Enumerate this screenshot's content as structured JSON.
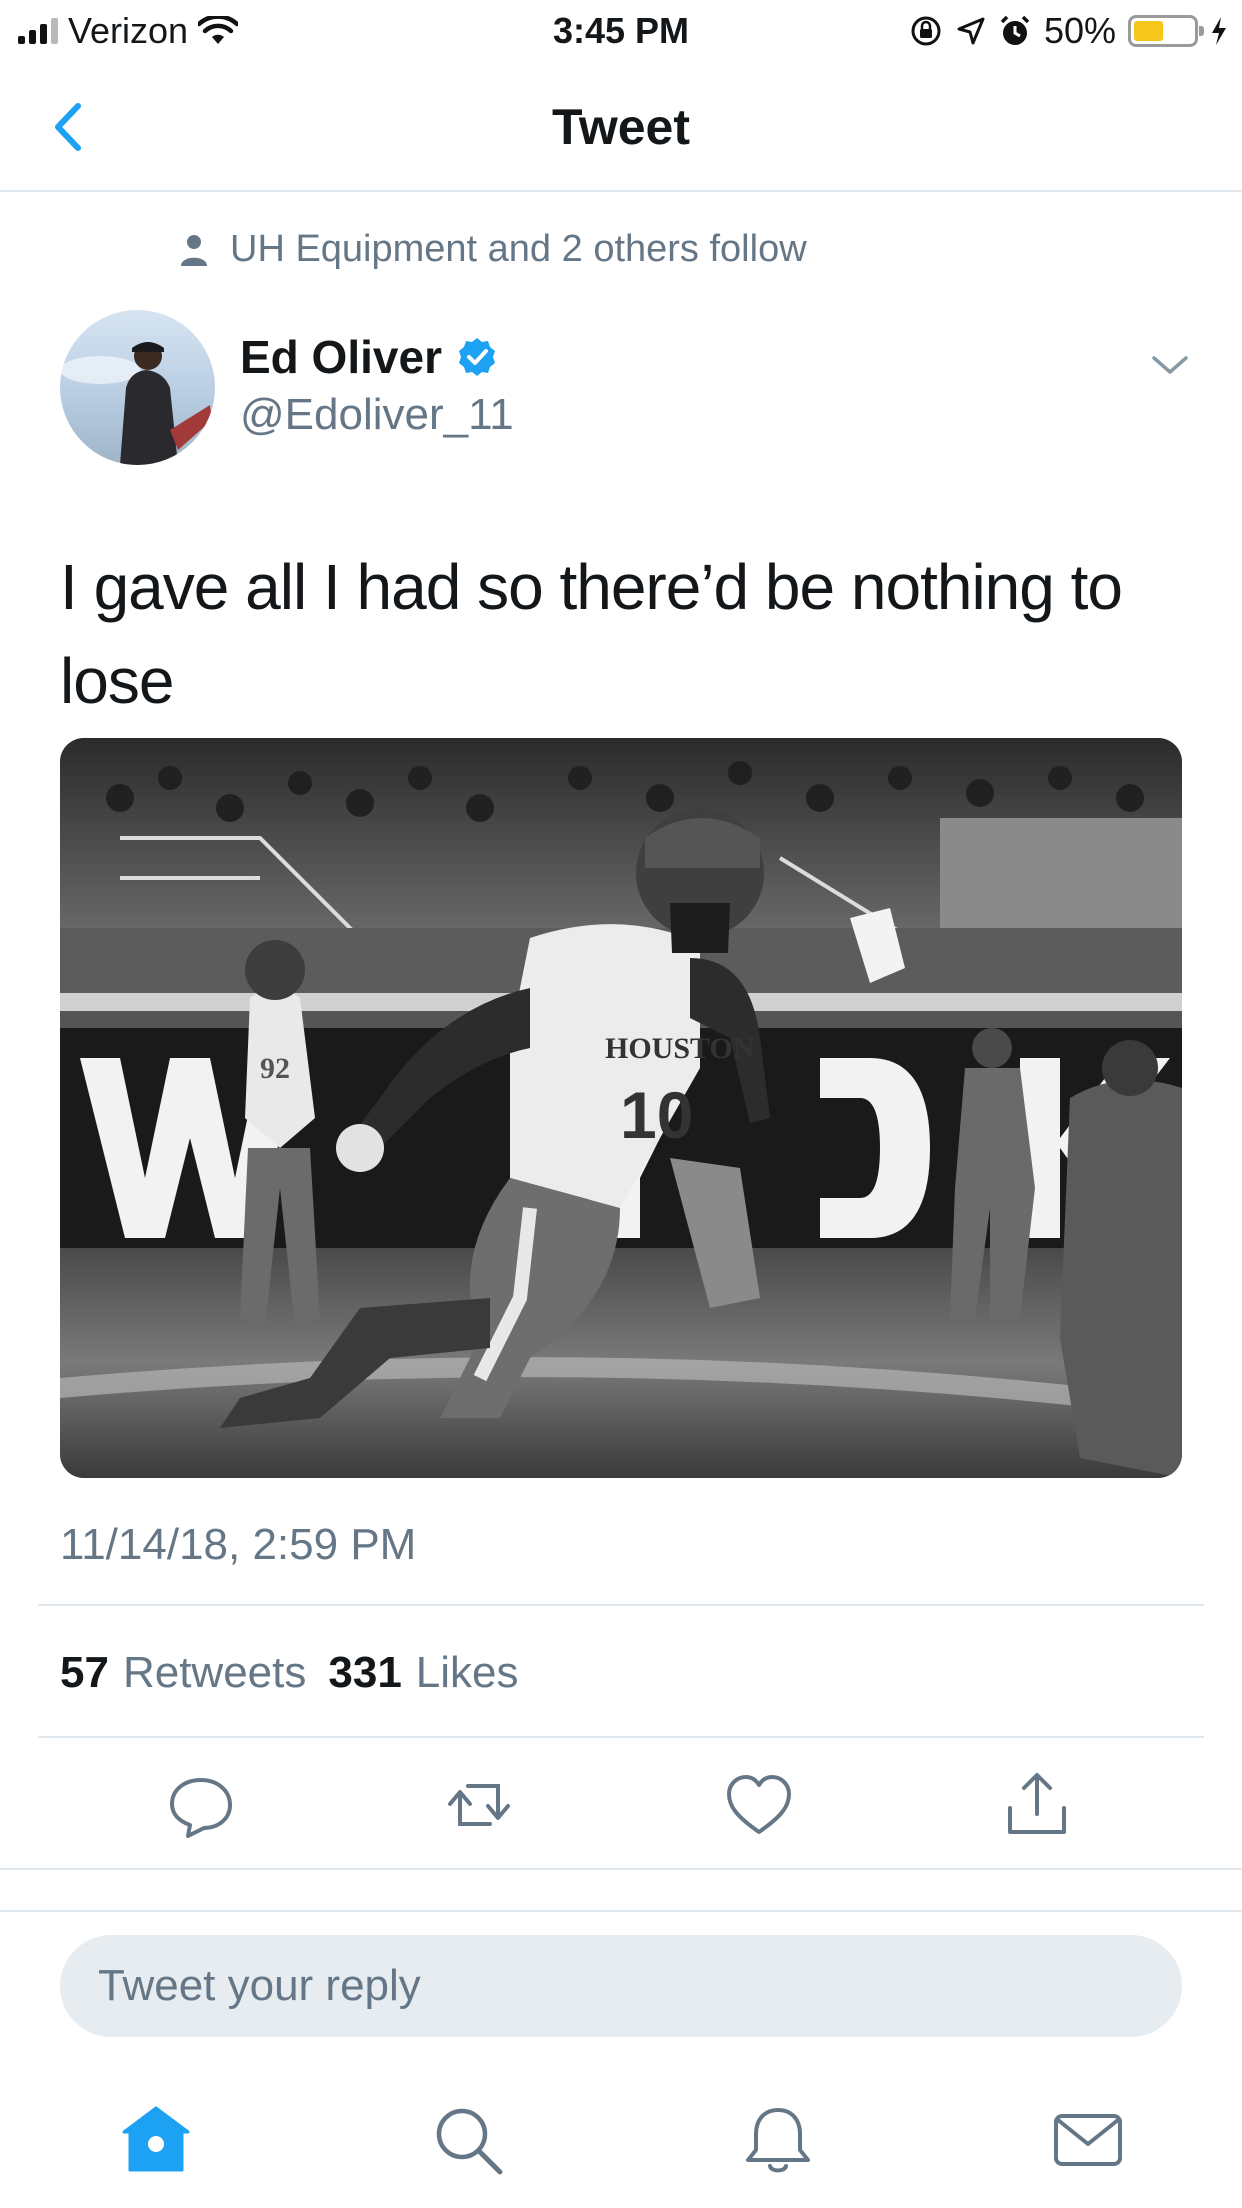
{
  "status_bar": {
    "carrier": "Verizon",
    "time": "3:45 PM",
    "battery_percent": "50%",
    "battery_level": 0.5,
    "battery_color": "#f5c71a"
  },
  "nav": {
    "title": "Tweet",
    "back_icon": "chevron-left-icon"
  },
  "tweet": {
    "social_context": "UH Equipment and 2 others follow",
    "author_name": "Ed Oliver",
    "verified": true,
    "handle": "@Edoliver_11",
    "text": "I gave all I had so there’d be nothing to lose",
    "timestamp": "11/14/18, 2:59 PM",
    "stats": {
      "retweets_count": "57",
      "retweets_label": "Retweets",
      "likes_count": "331",
      "likes_label": "Likes"
    },
    "media_jersey_text": "HOUSTON",
    "media_jersey_number": "10",
    "media_jersey_number_2": "92"
  },
  "actions": [
    "reply-icon",
    "retweet-icon",
    "like-icon",
    "share-icon"
  ],
  "reply": {
    "placeholder": "Tweet your reply"
  },
  "tabbar": {
    "items": [
      "home-icon",
      "search-icon",
      "notifications-icon",
      "messages-icon"
    ],
    "active_color": "#1da1f2"
  }
}
